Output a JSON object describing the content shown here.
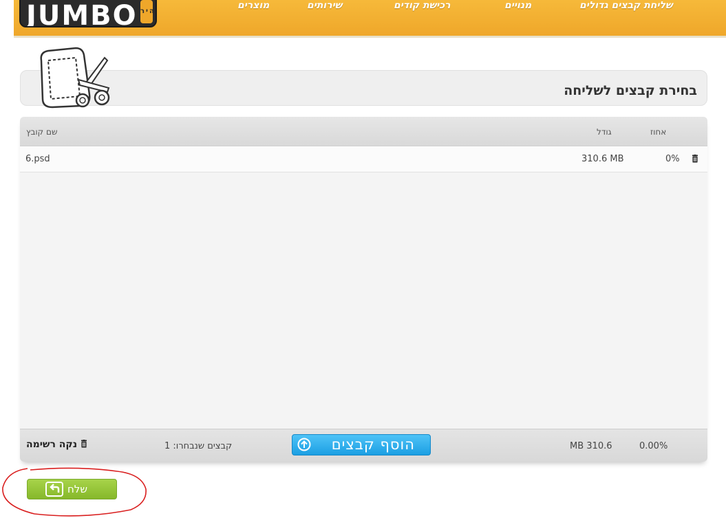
{
  "header": {
    "logo_text": "JUMBO",
    "logo_small": "מהיר",
    "nav": [
      "שליחת קבצים גדולים",
      "מנויים",
      "רכישת קודים",
      "שירותים",
      "מוצרים"
    ],
    "colors": {
      "bar": "#efa72a"
    }
  },
  "panel": {
    "title": "בחירת קבצים לשליחה"
  },
  "table": {
    "headers": {
      "name": "שם קובץ",
      "size": "גודל",
      "percent": "אחוז"
    },
    "rows": [
      {
        "name": "6.psd",
        "size": "310.6 MB",
        "percent": "0%"
      }
    ],
    "footer": {
      "clear_list": "נקה רשימה",
      "selected_count": "קבצים שנבחרו: 1",
      "add_files": "הוסף קבצים",
      "total_size": "310.6 MB",
      "total_percent": "0.00%"
    }
  },
  "send_button": {
    "label": "שלח"
  },
  "icons": {
    "trash": "trash-icon",
    "upload": "upload-arrow-icon",
    "send": "send-arrow-icon",
    "scissors": "scissors-icon"
  }
}
